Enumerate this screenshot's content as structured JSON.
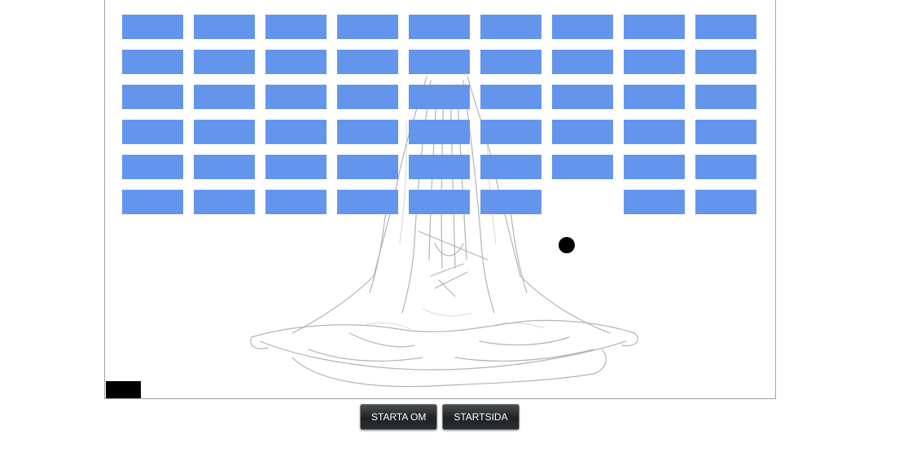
{
  "game": {
    "brick_color": "#6495ED",
    "ball_color": "#000000",
    "paddle_color": "#000000",
    "background_art": "pencil-sketch-meditating-figure",
    "rows": 6,
    "columns": 9,
    "bricks_present": [
      [
        1,
        1,
        1,
        1,
        1,
        1,
        1,
        1,
        1
      ],
      [
        1,
        1,
        1,
        1,
        1,
        1,
        1,
        1,
        1
      ],
      [
        1,
        1,
        1,
        1,
        1,
        1,
        1,
        1,
        1
      ],
      [
        1,
        1,
        1,
        1,
        1,
        1,
        1,
        1,
        1
      ],
      [
        1,
        1,
        1,
        1,
        1,
        1,
        1,
        1,
        1
      ],
      [
        1,
        1,
        1,
        1,
        1,
        1,
        0,
        1,
        1
      ]
    ]
  },
  "controls": {
    "restart_label": "STARTA OM",
    "home_label": "STARTSIDA"
  }
}
